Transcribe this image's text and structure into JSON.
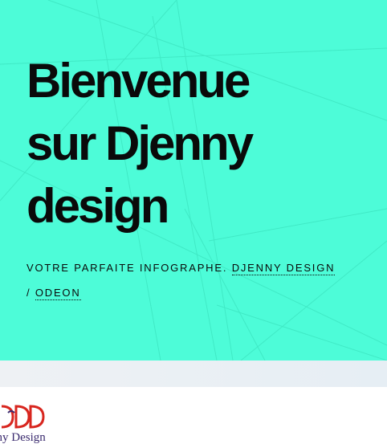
{
  "hero": {
    "title_lines": [
      "Bienvenue",
      "sur Djenny",
      "design"
    ],
    "tagline_prefix": "VOTRE PARFAITE INFOGRAPHE.",
    "link_brand": "DJENNY DESIGN",
    "separator": "/",
    "link_theme": "ODEON"
  },
  "logo": {
    "text": "nny Design"
  },
  "colors": {
    "hero_background": "#4dfcd8",
    "text": "#0a0a0a",
    "logo_red": "#d8261f",
    "logo_navy": "#3a2a6e"
  }
}
